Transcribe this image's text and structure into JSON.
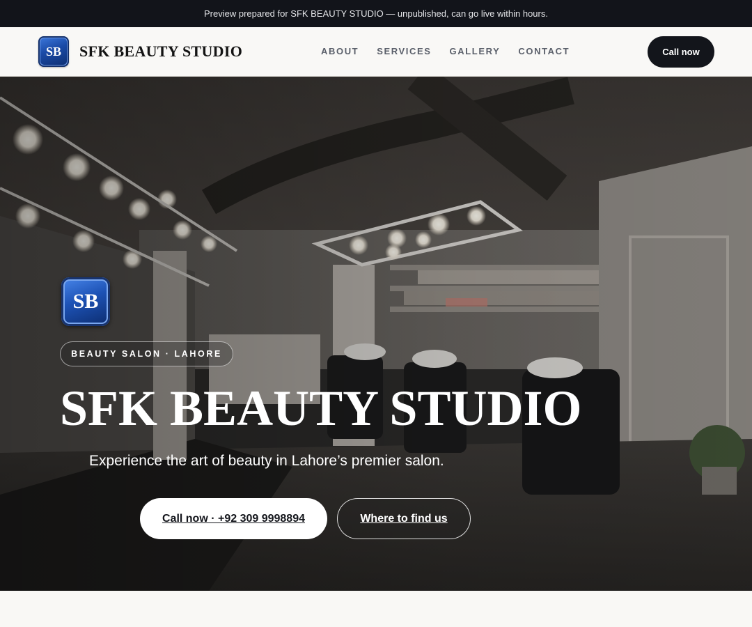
{
  "banner": {
    "text": "Preview prepared for SFK BEAUTY STUDIO — unpublished, can go live within hours."
  },
  "header": {
    "logo_initials": "SB",
    "brand": "SFK BEAUTY STUDIO",
    "nav": [
      "ABOUT",
      "SERVICES",
      "GALLERY",
      "CONTACT"
    ],
    "cta_label": "Call now"
  },
  "hero": {
    "logo_initials": "SB",
    "eyebrow": "BEAUTY SALON · LAHORE",
    "title": "SFK BEAUTY STUDIO",
    "subtitle": "Experience the art of beauty in Lahore’s premier salon.",
    "primary_button": "Call now · +92 309 9998894",
    "secondary_button": "Where to find us",
    "background_image": "salon-interior-photo"
  },
  "colors": {
    "dark": "#12141a",
    "logo_blue": "#1a4aa6",
    "page_bg": "#f9f8f5"
  }
}
